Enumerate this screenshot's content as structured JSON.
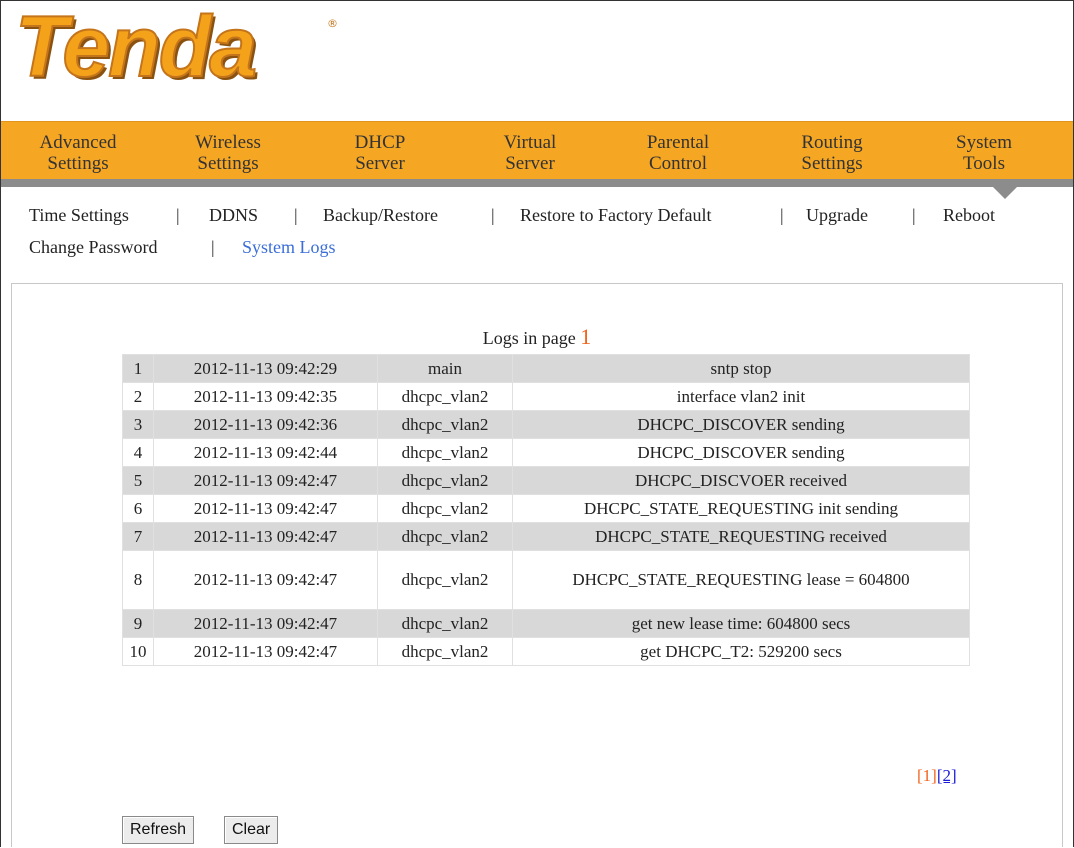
{
  "logo": {
    "text": "Tenda",
    "mark": "®"
  },
  "nav": [
    {
      "line1": "Advanced",
      "line2": "Settings"
    },
    {
      "line1": "Wireless",
      "line2": "Settings"
    },
    {
      "line1": "DHCP",
      "line2": "Server"
    },
    {
      "line1": "Virtual",
      "line2": "Server"
    },
    {
      "line1": "Parental",
      "line2": "Control"
    },
    {
      "line1": "Routing",
      "line2": "Settings"
    },
    {
      "line1": "System",
      "line2": "Tools"
    }
  ],
  "subnav": {
    "items": [
      "Time Settings",
      "DDNS",
      "Backup/Restore",
      "Restore to Factory Default",
      "Upgrade",
      "Reboot",
      "Change Password",
      "System Logs"
    ],
    "separator": "|",
    "active": "System Logs"
  },
  "logs": {
    "title_prefix": "Logs in page",
    "page": "1",
    "rows": [
      {
        "no": "1",
        "time": "2012-11-13 09:42:29",
        "source": "main",
        "message": "sntp stop"
      },
      {
        "no": "2",
        "time": "2012-11-13 09:42:35",
        "source": "dhcpc_vlan2",
        "message": "interface vlan2 init"
      },
      {
        "no": "3",
        "time": "2012-11-13 09:42:36",
        "source": "dhcpc_vlan2",
        "message": "DHCPC_DISCOVER sending"
      },
      {
        "no": "4",
        "time": "2012-11-13 09:42:44",
        "source": "dhcpc_vlan2",
        "message": "DHCPC_DISCOVER sending"
      },
      {
        "no": "5",
        "time": "2012-11-13 09:42:47",
        "source": "dhcpc_vlan2",
        "message": "DHCPC_DISCVOER received"
      },
      {
        "no": "6",
        "time": "2012-11-13 09:42:47",
        "source": "dhcpc_vlan2",
        "message": "DHCPC_STATE_REQUESTING init sending"
      },
      {
        "no": "7",
        "time": "2012-11-13 09:42:47",
        "source": "dhcpc_vlan2",
        "message": "DHCPC_STATE_REQUESTING received"
      },
      {
        "no": "8",
        "time": "2012-11-13 09:42:47",
        "source": "dhcpc_vlan2",
        "message": "DHCPC_STATE_REQUESTING lease = 604800"
      },
      {
        "no": "9",
        "time": "2012-11-13 09:42:47",
        "source": "dhcpc_vlan2",
        "message": "get new lease time: 604800 secs"
      },
      {
        "no": "10",
        "time": "2012-11-13 09:42:47",
        "source": "dhcpc_vlan2",
        "message": "get DHCPC_T2: 529200 secs"
      }
    ]
  },
  "pager": {
    "page1": "[1]",
    "page2": "[2]"
  },
  "buttons": {
    "refresh": "Refresh",
    "clear": "Clear"
  },
  "colors": {
    "brand_orange": "#f5a623",
    "nav_bar_gray": "#8c8c8c",
    "active_link": "#3a6ed8",
    "page_number": "#f0641e",
    "row_shade": "#d8d8d8"
  }
}
